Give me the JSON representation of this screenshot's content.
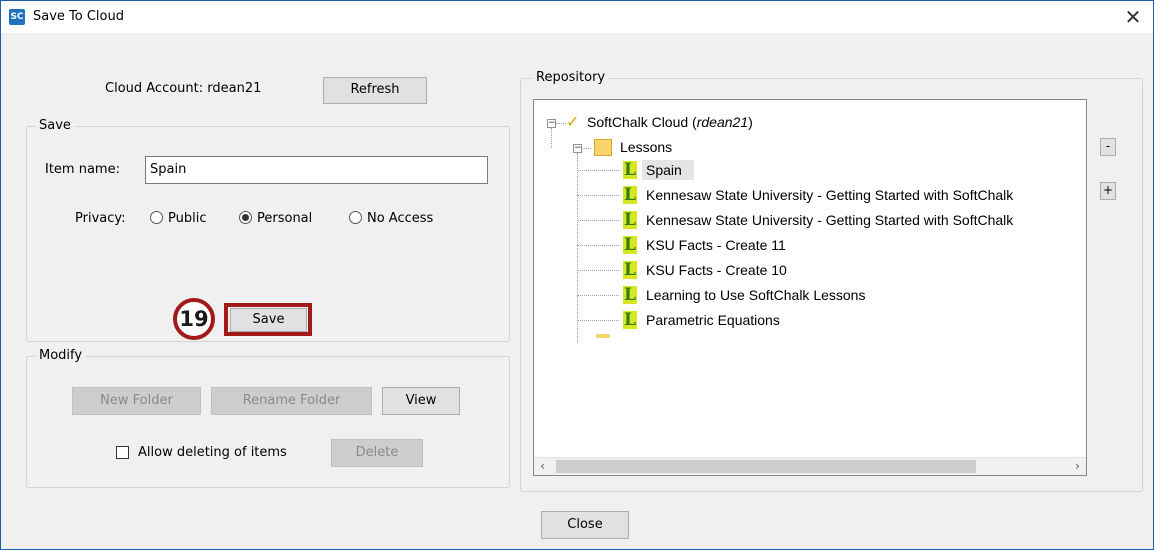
{
  "window": {
    "title": "Save To Cloud",
    "app_icon_text": "SC"
  },
  "account": {
    "label": "Cloud Account: rdean21",
    "refresh_label": "Refresh"
  },
  "save_group": {
    "legend": "Save",
    "item_name_label": "Item name:",
    "item_name_value": "Spain",
    "privacy_label": "Privacy:",
    "privacy_options": [
      "Public",
      "Personal",
      "No Access"
    ],
    "privacy_selected": "Personal",
    "save_label": "Save"
  },
  "annotation": {
    "step_number": "19",
    "color": "#a31a1a"
  },
  "modify_group": {
    "legend": "Modify",
    "new_folder_label": "New Folder",
    "rename_folder_label": "Rename Folder",
    "view_label": "View",
    "allow_delete_label": "Allow deleting of items",
    "allow_delete_checked": false,
    "delete_label": "Delete"
  },
  "repository": {
    "legend": "Repository",
    "root_label": "SoftChalk Cloud",
    "root_user": "rdean21",
    "folder_label": "Lessons",
    "items": [
      "Spain",
      "Kennesaw State University - Getting Started with SoftChalk",
      "Kennesaw State University - Getting Started with SoftChalk",
      "KSU Facts - Create 11",
      "KSU Facts - Create 10",
      "Learning to Use SoftChalk Lessons",
      "Parametric Equations"
    ],
    "selected_item": "Spain",
    "collapse_label": "-",
    "expand_label": "+"
  },
  "close_label": "Close"
}
